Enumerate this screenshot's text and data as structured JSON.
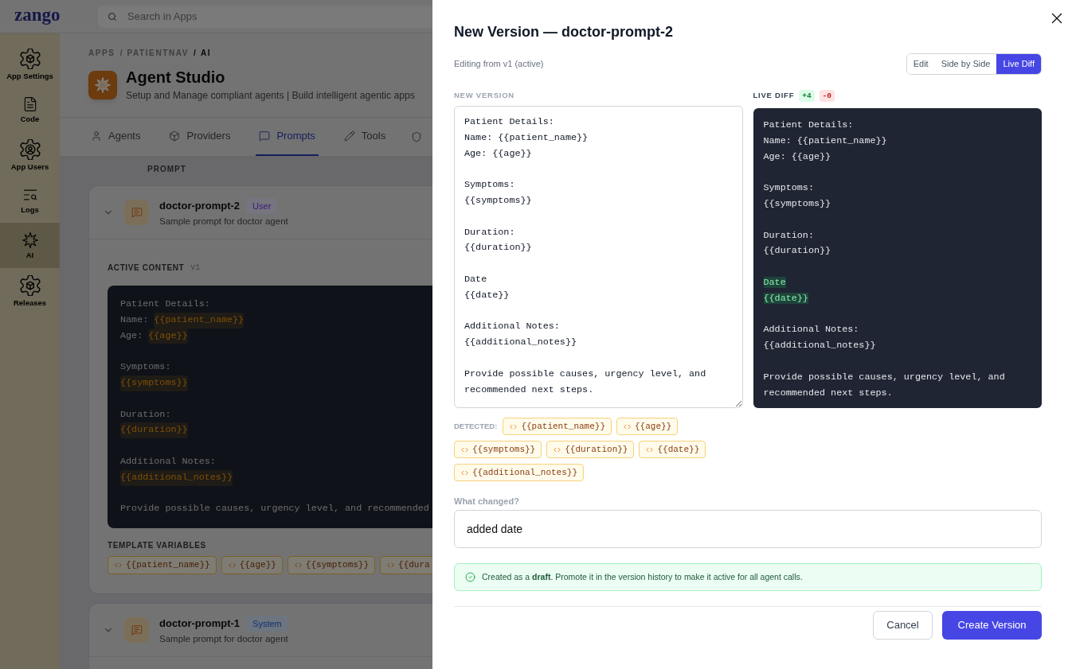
{
  "app": {
    "logo": "zango",
    "search": {
      "placeholder": "Search in Apps"
    }
  },
  "sidebar": {
    "items": [
      {
        "label": "App Settings",
        "selected": false
      },
      {
        "label": "Code",
        "selected": false
      },
      {
        "label": "App Users",
        "selected": false
      },
      {
        "label": "Logs",
        "selected": false
      },
      {
        "label": "AI",
        "selected": true
      },
      {
        "label": "Releases",
        "selected": false
      }
    ]
  },
  "page": {
    "breadcrumb": [
      {
        "kind": "link",
        "text": "APPS",
        "current": false
      },
      {
        "kind": "separator",
        "text": "/",
        "current": false
      },
      {
        "kind": "link",
        "text": "PATIENTNAV",
        "current": false
      },
      {
        "kind": "separator",
        "text": "/",
        "current": true
      },
      {
        "kind": "link",
        "text": "AI",
        "current": true
      }
    ],
    "title": "Agent Studio",
    "subtitle": "Setup and Manage compliant agents | Build intelligent agentic apps",
    "tabs": [
      {
        "label": "Agents",
        "selected": false
      },
      {
        "label": "Providers",
        "selected": false
      },
      {
        "label": "Prompts",
        "selected": true
      },
      {
        "label": "Tools",
        "selected": false
      }
    ]
  },
  "prompts": {
    "column": "PROMPT",
    "items": [
      {
        "name": "doctor-prompt-2",
        "type": "User",
        "kind": "user",
        "description": "Sample prompt for doctor agent",
        "active_content": {
          "label": "ACTIVE CONTENT",
          "version": "v1",
          "lines": [
            {
              "kind": "text",
              "parts": [
                {
                  "kind": "plain",
                  "text": "Patient Details:"
                }
              ]
            },
            {
              "kind": "text",
              "parts": [
                {
                  "kind": "plain",
                  "text": "Name:"
                },
                {
                  "kind": "variable",
                  "text": "{{patient_name}}"
                }
              ]
            },
            {
              "kind": "text",
              "parts": [
                {
                  "kind": "plain",
                  "text": "Age:"
                },
                {
                  "kind": "variable",
                  "text": "{{age}}"
                }
              ]
            },
            {
              "kind": "blank"
            },
            {
              "kind": "text",
              "parts": [
                {
                  "kind": "plain",
                  "text": "Symptoms:"
                }
              ]
            },
            {
              "kind": "text",
              "parts": [
                {
                  "kind": "variable",
                  "text": "{{symptoms}}"
                }
              ]
            },
            {
              "kind": "blank"
            },
            {
              "kind": "text",
              "parts": [
                {
                  "kind": "plain",
                  "text": "Duration:"
                }
              ]
            },
            {
              "kind": "text",
              "parts": [
                {
                  "kind": "variable",
                  "text": "{{duration}}"
                }
              ]
            },
            {
              "kind": "blank"
            },
            {
              "kind": "text",
              "parts": [
                {
                  "kind": "plain",
                  "text": "Additional Notes:"
                }
              ]
            },
            {
              "kind": "text",
              "parts": [
                {
                  "kind": "variable",
                  "text": "{{additional_notes}}"
                }
              ]
            },
            {
              "kind": "blank"
            },
            {
              "kind": "text",
              "parts": [
                {
                  "kind": "plain",
                  "text": "Provide possible causes, urgency level, and recommended"
                }
              ]
            }
          ]
        },
        "template_variables": {
          "label": "TEMPLATE VARIABLES",
          "items": [
            "{{patient_name}}",
            "{{age}}",
            "{{symptoms}}",
            "{{dura"
          ]
        }
      },
      {
        "name": "doctor-prompt-1",
        "type": "System",
        "kind": "system",
        "description": "Sample prompt for doctor agent"
      }
    ]
  },
  "dialog": {
    "title": "New Version — doctor-prompt-2",
    "subtitle": "Editing from v1 (active)",
    "view_modes": [
      {
        "label": "Edit",
        "selected": false
      },
      {
        "label": "Side by Side",
        "selected": false
      },
      {
        "label": "Live Diff",
        "selected": true
      }
    ],
    "editor": {
      "label": "NEW VERSION",
      "value": "Patient Details:\nName: {{patient_name}}\nAge: {{age}}\n\nSymptoms:\n{{symptoms}}\n\nDuration:\n{{duration}}\n\nDate\n{{date}}\n\nAdditional Notes:\n{{additional_notes}}\n\nProvide possible causes, urgency level, and recommended next steps."
    },
    "diff": {
      "label": "LIVE DIFF",
      "added": "+4",
      "removed": "-0",
      "lines": [
        {
          "kind": "same",
          "text": "Patient Details:"
        },
        {
          "kind": "same",
          "text": "Name: {{patient_name}}"
        },
        {
          "kind": "same",
          "text": "Age: {{age}}"
        },
        {
          "kind": "blank"
        },
        {
          "kind": "same",
          "text": "Symptoms:"
        },
        {
          "kind": "same",
          "text": "{{symptoms}}"
        },
        {
          "kind": "blank"
        },
        {
          "kind": "same",
          "text": "Duration:"
        },
        {
          "kind": "same",
          "text": "{{duration}}"
        },
        {
          "kind": "blank"
        },
        {
          "kind": "added",
          "text": "Date"
        },
        {
          "kind": "added",
          "text": "{{date}}"
        },
        {
          "kind": "blank"
        },
        {
          "kind": "same",
          "text": "Additional Notes:"
        },
        {
          "kind": "same",
          "text": "{{additional_notes}}"
        },
        {
          "kind": "blank"
        },
        {
          "kind": "same",
          "text": "Provide possible causes, urgency level, and recommended next steps."
        }
      ]
    },
    "detected": {
      "label": "DETECTED:",
      "items": [
        "{{patient_name}}",
        "{{age}}",
        "{{symptoms}}",
        "{{duration}}",
        "{{date}}",
        "{{additional_notes}}"
      ]
    },
    "change_note": {
      "label": "What changed?",
      "value": "added date"
    },
    "notice": "Created as a **draft**. Promote it in the version history to make it active for all agent calls.",
    "buttons": [
      {
        "label": "Cancel",
        "kind": "secondary"
      },
      {
        "label": "Create Version",
        "kind": "primary"
      }
    ]
  }
}
